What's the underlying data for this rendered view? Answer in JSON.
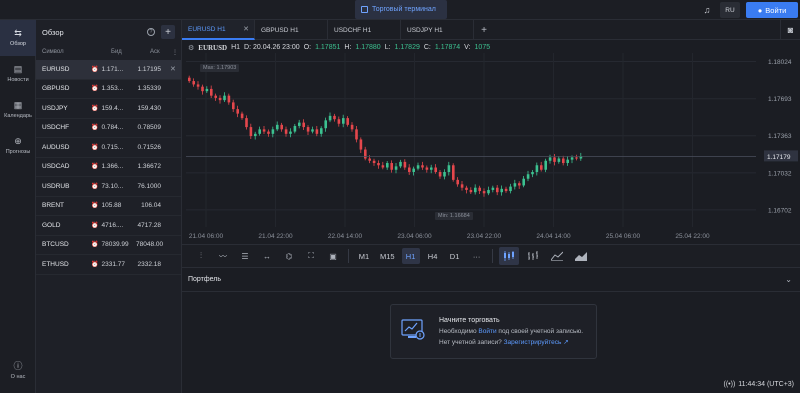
{
  "header": {
    "terminal_label": "Торговый терминал",
    "lang": "RU",
    "login_label": "Войти"
  },
  "nav": {
    "items": [
      {
        "label": "Обзор",
        "icon": "overview-icon"
      },
      {
        "label": "Новости",
        "icon": "news-icon"
      },
      {
        "label": "Календарь",
        "icon": "calendar-icon"
      },
      {
        "label": "Прогнозы",
        "icon": "forecast-icon"
      }
    ],
    "about": "О нас"
  },
  "watchlist": {
    "title": "Обзор",
    "col_symbol": "Символ",
    "col_bid": "Бид",
    "col_ask": "Аск",
    "rows": [
      {
        "symbol": "EURUSD",
        "bid": "1.171...",
        "ask": "1.17195"
      },
      {
        "symbol": "GBPUSD",
        "bid": "1.353...",
        "ask": "1.35339"
      },
      {
        "symbol": "USDJPY",
        "bid": "159.4...",
        "ask": "159.430"
      },
      {
        "symbol": "USDCHF",
        "bid": "0.784...",
        "ask": "0.78509"
      },
      {
        "symbol": "AUDUSD",
        "bid": "0.715...",
        "ask": "0.71526"
      },
      {
        "symbol": "USDCAD",
        "bid": "1.366...",
        "ask": "1.36672"
      },
      {
        "symbol": "USDRUB",
        "bid": "73.10...",
        "ask": "76.1000"
      },
      {
        "symbol": "BRENT",
        "bid": "105.88",
        "ask": "106.04"
      },
      {
        "symbol": "GOLD",
        "bid": "4716....",
        "ask": "4717.28"
      },
      {
        "symbol": "BTCUSD",
        "bid": "78039.99",
        "ask": "78048.00"
      },
      {
        "symbol": "ETHUSD",
        "bid": "2331.77",
        "ask": "2332.18"
      }
    ]
  },
  "tabs": [
    "EURUSD H1",
    "GBPUSD H1",
    "USDCHF H1",
    "USDJPY H1"
  ],
  "chart": {
    "symbol": "EURUSD",
    "tf": "H1",
    "d": "D: 20.04.26 23:00",
    "o_label": "O:",
    "o": "1.17851",
    "h_label": "H:",
    "h": "1.17880",
    "l_label": "L:",
    "l": "1.17829",
    "c_label": "C:",
    "c": "1.17874",
    "v_label": "V:",
    "v": "1075",
    "max_label": "Max: 1.17903",
    "min_label": "Min: 1.16684",
    "current_price": "1.17179"
  },
  "chart_data": {
    "type": "candlestick",
    "y_ticks": [
      "1.18024",
      "1.17693",
      "1.17363",
      "1.17032",
      "1.16702"
    ],
    "x_ticks": [
      "21.04 06:00",
      "21.04 22:00",
      "22.04 14:00",
      "23.04 06:00",
      "23.04 22:00",
      "24.04 14:00",
      "25.04 06:00",
      "25.04 22:00"
    ],
    "ylim": [
      1.1655,
      1.181
    ],
    "up_color": "#3cc190",
    "down_color": "#e5474c",
    "closes": [
      1.1785,
      1.1782,
      1.178,
      1.1776,
      1.1778,
      1.1772,
      1.177,
      1.1768,
      1.1772,
      1.1766,
      1.176,
      1.1756,
      1.1752,
      1.1744,
      1.1736,
      1.1738,
      1.1742,
      1.174,
      1.1738,
      1.1742,
      1.1746,
      1.1742,
      1.1738,
      1.174,
      1.1745,
      1.1748,
      1.1744,
      1.174,
      1.1742,
      1.1738,
      1.1743,
      1.175,
      1.1754,
      1.1751,
      1.1747,
      1.1752,
      1.1746,
      1.1742,
      1.1733,
      1.1724,
      1.1716,
      1.1714,
      1.1712,
      1.171,
      1.1708,
      1.1712,
      1.1706,
      1.1709,
      1.1713,
      1.1708,
      1.1704,
      1.1707,
      1.171,
      1.1708,
      1.1706,
      1.1708,
      1.1704,
      1.17,
      1.1704,
      1.171,
      1.1697,
      1.1693,
      1.169,
      1.1688,
      1.1686,
      1.169,
      1.1687,
      1.1685,
      1.1688,
      1.169,
      1.1686,
      1.1689,
      1.1687,
      1.1691,
      1.1694,
      1.1692,
      1.1698,
      1.1702,
      1.1704,
      1.171,
      1.1706,
      1.1714,
      1.1717,
      1.1713,
      1.1716,
      1.1712,
      1.1715,
      1.1717,
      1.1716,
      1.1718
    ]
  },
  "toolbar": {
    "timeframes": [
      "M1",
      "M15",
      "H1",
      "H4",
      "D1",
      "···"
    ],
    "active_tf": "H1"
  },
  "portfolio": {
    "title": "Портфель",
    "start_title": "Начните торговать",
    "line1_pre": "Необходимо",
    "line1_link": "Войти",
    "line1_post": "под своей учетной записью.",
    "line2_pre": "Нет учетной записи?",
    "line2_link": "Зарегистрируйтесь"
  },
  "status": {
    "time": "11:44:34 (UTC+3)"
  }
}
